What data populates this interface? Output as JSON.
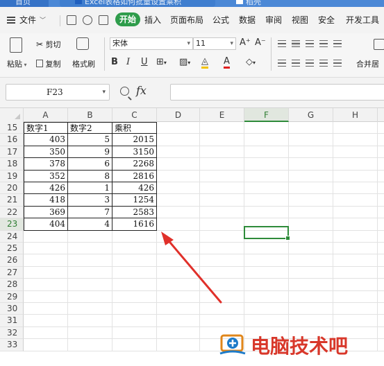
{
  "titlebar": {
    "home_tab": "首页",
    "doc_tab": "Excel表格如何批量设置乘积",
    "active_tab": "稻壳"
  },
  "menubar": {
    "file_label": "文件",
    "start_label": "开始",
    "items": [
      "插入",
      "页面布局",
      "公式",
      "数据",
      "审阅",
      "视图",
      "安全",
      "开发工具"
    ]
  },
  "ribbon": {
    "paste_label": "粘贴",
    "cut_label": "剪切",
    "copy_label": "复制",
    "format_painter_label": "格式刷",
    "font_name": "宋体",
    "font_size": "11",
    "merge_label": "合并居"
  },
  "formula_bar": {
    "name_box": "F23",
    "fx_label": "fx",
    "formula": ""
  },
  "grid": {
    "columns": [
      "A",
      "B",
      "C",
      "D",
      "E",
      "F",
      "G",
      "H"
    ],
    "selected_column": "F",
    "selected_row": "23",
    "rows": [
      {
        "n": "15",
        "a": "数字1",
        "b": "数字2",
        "c": "乘积"
      },
      {
        "n": "16",
        "a": "403",
        "b": "5",
        "c": "2015"
      },
      {
        "n": "17",
        "a": "350",
        "b": "9",
        "c": "3150"
      },
      {
        "n": "18",
        "a": "378",
        "b": "6",
        "c": "2268"
      },
      {
        "n": "19",
        "a": "352",
        "b": "8",
        "c": "2816"
      },
      {
        "n": "20",
        "a": "426",
        "b": "1",
        "c": "426"
      },
      {
        "n": "21",
        "a": "418",
        "b": "3",
        "c": "1254"
      },
      {
        "n": "22",
        "a": "369",
        "b": "7",
        "c": "2583"
      },
      {
        "n": "23",
        "a": "404",
        "b": "4",
        "c": "1616"
      },
      {
        "n": "24"
      },
      {
        "n": "25"
      },
      {
        "n": "26"
      },
      {
        "n": "27"
      },
      {
        "n": "28"
      },
      {
        "n": "29"
      },
      {
        "n": "30"
      },
      {
        "n": "31"
      },
      {
        "n": "32"
      },
      {
        "n": "33"
      }
    ]
  },
  "watermark": {
    "text": "电脑技术吧"
  },
  "colors": {
    "accent_green": "#2e8b3a",
    "title_blue": "#4b88d6",
    "arrow_red": "#e0302a",
    "watermark_red": "#d8372a"
  }
}
